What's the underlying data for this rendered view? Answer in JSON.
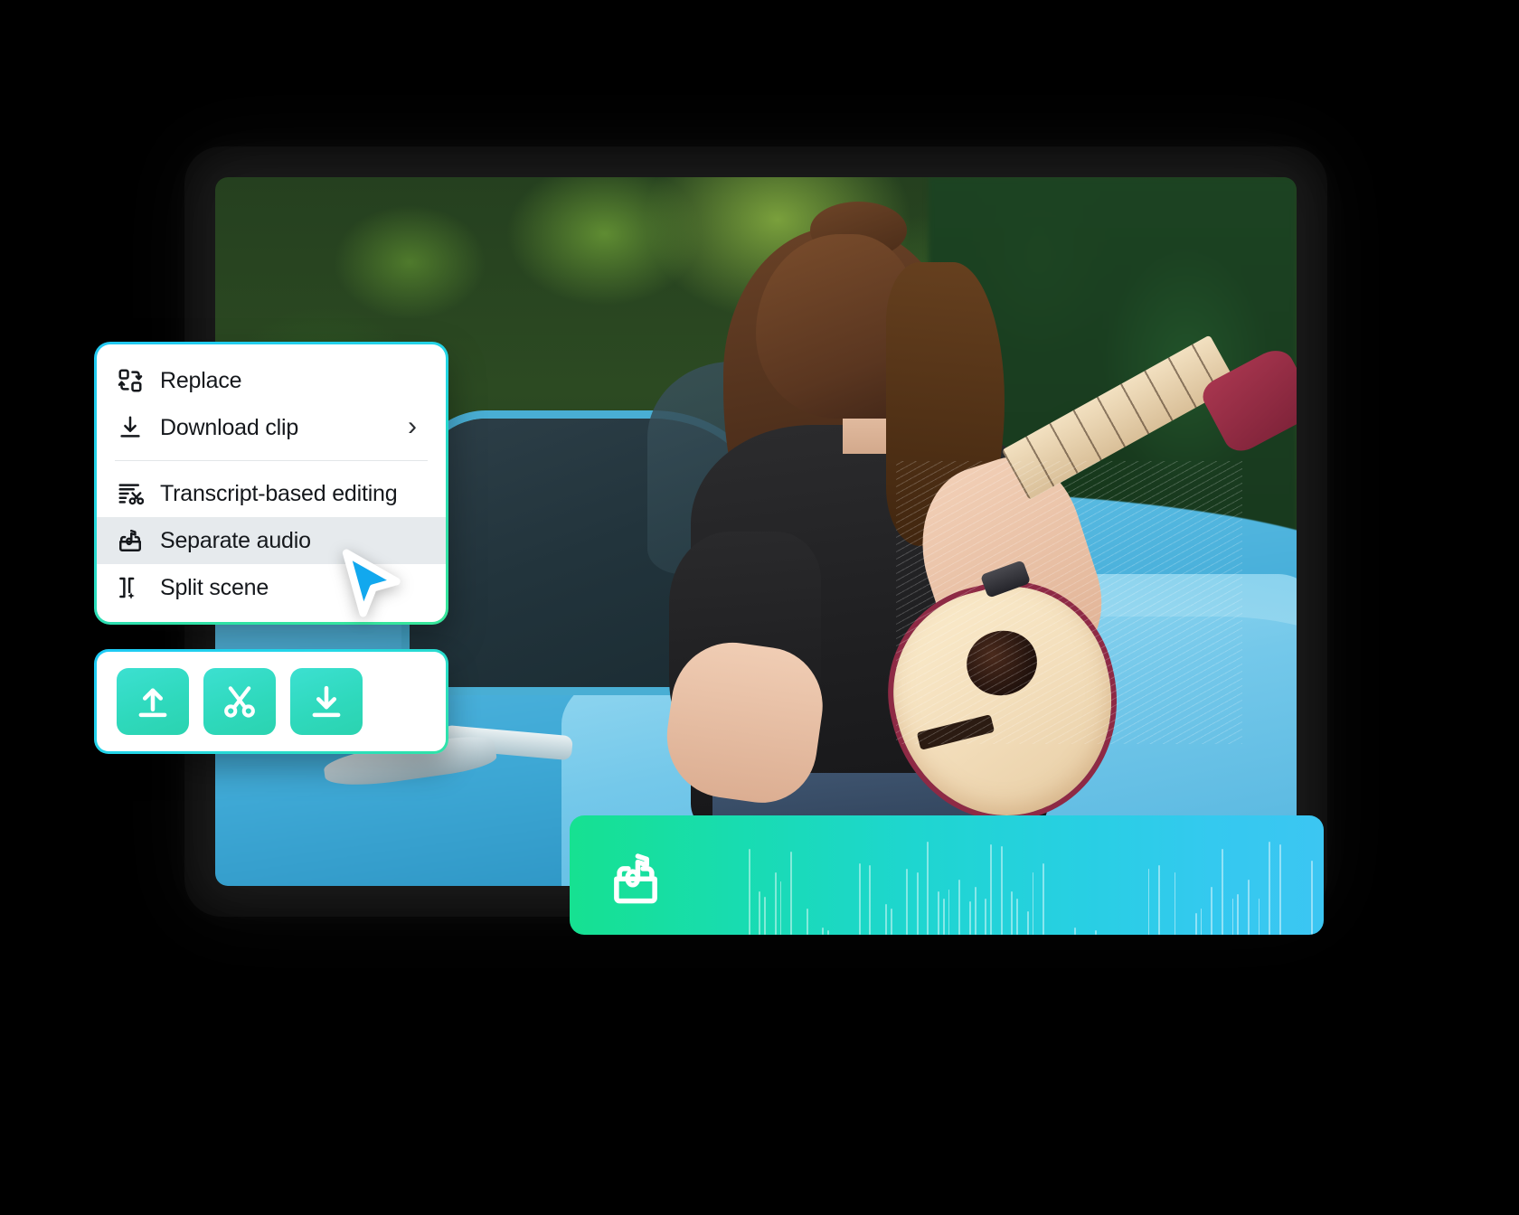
{
  "app": {
    "accent_cyan": "#22c8f2",
    "accent_green": "#37e69a",
    "accent_teal_button": "#2fd9bd",
    "cursor_color": "#12a8ee",
    "menu_highlight": "#e6eaed"
  },
  "context_menu": {
    "name": "clip-context-menu",
    "items": [
      {
        "id": "replace",
        "label": "Replace",
        "icon": "replace-icon",
        "has_submenu": false,
        "highlighted": false
      },
      {
        "id": "download-clip",
        "label": "Download clip",
        "icon": "download-icon",
        "has_submenu": true,
        "highlighted": false
      },
      {
        "id": "transcript",
        "label": "Transcript-based editing",
        "icon": "transcript-scissors-icon",
        "has_submenu": false,
        "highlighted": false
      },
      {
        "id": "separate-audio",
        "label": "Separate audio",
        "icon": "separate-audio-icon",
        "has_submenu": false,
        "highlighted": true
      },
      {
        "id": "split-scene",
        "label": "Split scene",
        "icon": "split-scene-icon",
        "has_submenu": false,
        "highlighted": false
      }
    ],
    "divider_after_index": 1,
    "submenu_glyph": "›"
  },
  "toolbar": {
    "name": "clip-mini-toolbar",
    "buttons": [
      {
        "id": "upload",
        "icon": "upload-icon",
        "label": "Upload"
      },
      {
        "id": "cut",
        "icon": "scissors-icon",
        "label": "Cut"
      },
      {
        "id": "download",
        "icon": "download-icon",
        "label": "Download"
      }
    ]
  },
  "audio_track": {
    "name": "separated-audio-track",
    "icon": "audio-extract-icon",
    "gradient_from": "#16e191",
    "gradient_to": "#3cc6f2",
    "waveform": [
      0.0,
      0.0,
      0.0,
      0.0,
      0.0,
      0.0,
      0.0,
      0.0,
      0.0,
      0.0,
      0.0,
      0.0,
      0.72,
      0.0,
      0.36,
      0.32,
      0.0,
      0.52,
      0.45,
      0.0,
      0.7,
      0.0,
      0.0,
      0.22,
      0.0,
      0.0,
      0.06,
      0.04,
      0.0,
      0.0,
      0.0,
      0.0,
      0.0,
      0.6,
      0.0,
      0.58,
      0.0,
      0.0,
      0.26,
      0.22,
      0.0,
      0.0,
      0.55,
      0.0,
      0.52,
      0.0,
      0.78,
      0.0,
      0.36,
      0.3,
      0.38,
      0.0,
      0.46,
      0.0,
      0.28,
      0.4,
      0.0,
      0.3,
      0.76,
      0.0,
      0.74,
      0.0,
      0.36,
      0.3,
      0.0,
      0.2,
      0.52,
      0.0,
      0.6,
      0.0,
      0.0,
      0.0,
      0.0,
      0.0,
      0.06,
      0.0,
      0.0,
      0.0,
      0.04,
      0.0,
      0.0,
      0.0,
      0.0,
      0.0,
      0.0,
      0.0,
      0.0,
      0.0,
      0.55,
      0.0,
      0.58,
      0.0,
      0.0,
      0.52,
      0.0,
      0.0,
      0.0,
      0.18,
      0.22,
      0.0,
      0.4,
      0.0,
      0.72,
      0.0,
      0.3,
      0.34,
      0.0,
      0.46,
      0.0,
      0.3,
      0.0,
      0.78,
      0.0,
      0.76,
      0.0,
      0.0,
      0.0,
      0.0,
      0.0,
      0.62
    ]
  },
  "video": {
    "name": "video-preview",
    "description": "Woman with long brown hair in a black t-shirt playing a ukulele while leaning on a light-blue vintage car, green foliage behind her."
  }
}
